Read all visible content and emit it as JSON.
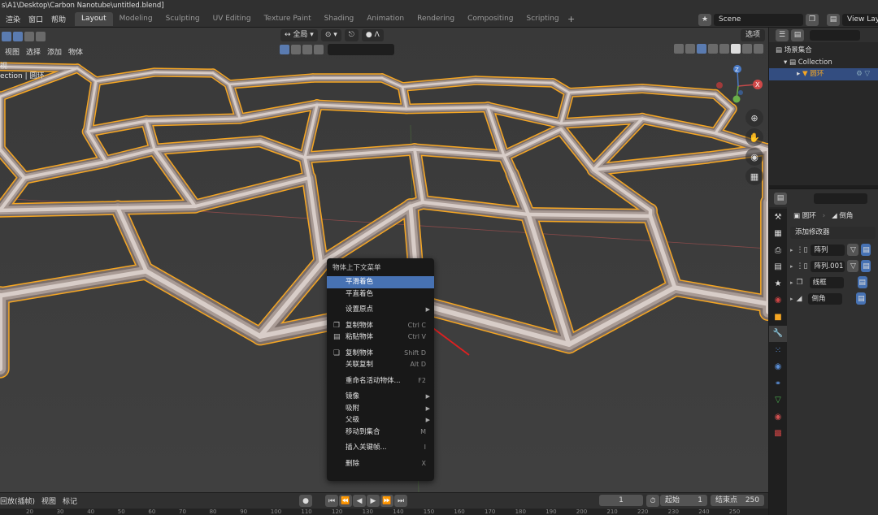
{
  "window": {
    "title": "s\\A1\\Desktop\\Carbon Nanotube\\untitled.blend]"
  },
  "topbar": {
    "menu": [
      "渲染",
      "窗口",
      "帮助"
    ],
    "workspaces": [
      "Layout",
      "Modeling",
      "Sculpting",
      "UV Editing",
      "Texture Paint",
      "Shading",
      "Animation",
      "Rendering",
      "Compositing",
      "Scripting"
    ],
    "active_workspace": "Layout",
    "add_tab": "+",
    "scene_label": "Scene",
    "view_layer_label": "View Laye"
  },
  "viewport": {
    "header_menu": [
      "视图",
      "选择",
      "添加",
      "物体"
    ],
    "transform_orientation": "全局",
    "options_label": "选项",
    "info_line1": "视",
    "info_line2": "ection | 圆环",
    "accent_color": "#f5a623",
    "tube_color": "#a89a94"
  },
  "context_menu": {
    "title": "物体上下文菜单",
    "items": [
      {
        "label": "平滑着色",
        "shortcut": "",
        "highlight": true
      },
      {
        "label": "平直着色",
        "shortcut": ""
      },
      {
        "label": "设置原点",
        "shortcut": "",
        "submenu": true
      },
      {
        "label": "复制物体",
        "shortcut": "Ctrl C",
        "icon": "copy-icon"
      },
      {
        "label": "粘贴物体",
        "shortcut": "Ctrl V",
        "icon": "paste-icon"
      },
      {
        "label": "复制物体",
        "shortcut": "Shift D",
        "icon": "duplicate-icon"
      },
      {
        "label": "关联复制",
        "shortcut": "Alt D"
      },
      {
        "label": "重命名活动物体...",
        "shortcut": "F2"
      },
      {
        "label": "镜像",
        "shortcut": "",
        "submenu": true
      },
      {
        "label": "吸附",
        "shortcut": "",
        "submenu": true
      },
      {
        "label": "父级",
        "shortcut": "",
        "submenu": true
      },
      {
        "label": "移动到集合",
        "shortcut": "M"
      },
      {
        "label": "插入关键帧...",
        "shortcut": "I"
      },
      {
        "label": "删除",
        "shortcut": "X"
      }
    ]
  },
  "outliner": {
    "scene_collection": "场景集合",
    "collection": "Collection",
    "object": "圆环"
  },
  "properties": {
    "object_name": "圆环",
    "modifier_crumb": "倒角",
    "add_modifier": "添加修改器",
    "modifiers": [
      "阵列",
      "阵列.001",
      "线框",
      "倒角"
    ]
  },
  "timeline": {
    "playback_label": "回放(插帧)",
    "view_label": "视图",
    "marker_label": "标记",
    "current_frame": "1",
    "start_label": "起始",
    "start_value": "1",
    "end_label": "结束点",
    "end_value": "250",
    "ruler": [
      "20",
      "30",
      "40",
      "50",
      "60",
      "70",
      "80",
      "90",
      "100",
      "110",
      "120",
      "130",
      "140",
      "150",
      "160",
      "170",
      "180",
      "190",
      "200",
      "210",
      "220",
      "230",
      "240",
      "250"
    ]
  }
}
